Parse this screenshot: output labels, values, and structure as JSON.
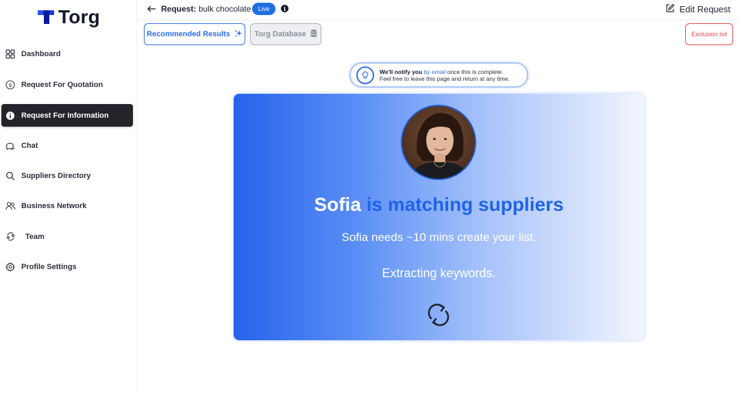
{
  "brand": {
    "name": "Torg"
  },
  "sidebar": {
    "items": [
      {
        "label": "Dashboard",
        "icon": "grid-icon",
        "active": false
      },
      {
        "label": "Request For Quotation",
        "icon": "dollar-circle-icon",
        "active": false
      },
      {
        "label": "Request For Information",
        "icon": "info-circle-icon",
        "active": true
      },
      {
        "label": "Chat",
        "icon": "chat-bubbles-icon",
        "active": false
      },
      {
        "label": "Suppliers Directory",
        "icon": "search-icon",
        "active": false
      },
      {
        "label": "Business Network",
        "icon": "people-icon",
        "active": false
      },
      {
        "label": "Team",
        "icon": "team-icon",
        "active": false
      },
      {
        "label": "Profile Settings",
        "icon": "gear-icon",
        "active": false
      }
    ]
  },
  "header": {
    "request_prefix": "Request:",
    "request_name": "bulk chocolate",
    "status_badge": "Live",
    "info_glyph": "i",
    "edit_label": "Edit Request"
  },
  "tabs": {
    "recommended": "Recommended Results",
    "database": "Torg Database",
    "exclusion": "Exclusion list"
  },
  "notice": {
    "bold": "We'll notify you",
    "link": "by email",
    "rest": "once this is complete.",
    "line2": "Feel free to leave this page and return at any time."
  },
  "card": {
    "agent_name": "Sofia",
    "headline_rest": "is matching suppliers",
    "eta_text": "Sofia needs ~10 mins create your list.",
    "status_text": "Extracting keywords."
  },
  "colors": {
    "accent": "#2f6ee8",
    "active_nav": "#23252b",
    "danger": "#e04848",
    "live_badge": "#1f6fe3"
  }
}
